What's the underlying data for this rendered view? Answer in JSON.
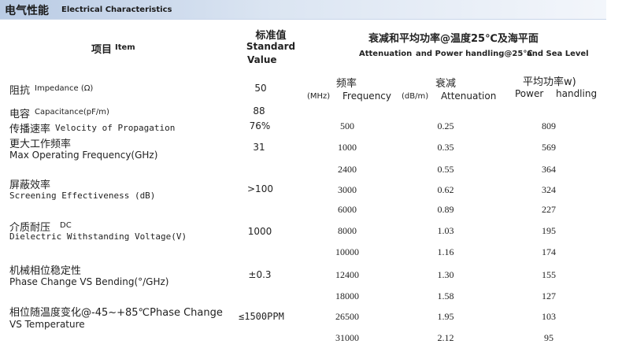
{
  "section": {
    "title_zh": "电气性能",
    "title_en": "Electrical Characteristics"
  },
  "headers": {
    "item_zh": "项目",
    "item_en": "Item",
    "std_zh": "标准值",
    "std_en1": "Standard",
    "std_en2": "Value",
    "atten_zh": "衰减和平均功率@温度25℃及海平面",
    "atten_en_a": "Attenuation",
    "atten_en_b": "and Power handling@25℃",
    "atten_en_c": "and Sea Level",
    "freq_unit": "(MHz)",
    "freq_zh": "频率",
    "freq_en": "Frequency",
    "att_unit": "(dB/m)",
    "att_zh": "衰减",
    "att_en": "Attenuation",
    "pow_zh": "平均功率w)",
    "pow_en1": "Power",
    "pow_en2": "handling"
  },
  "items": [
    {
      "zh": "阻抗",
      "en": "Impedance (Ω)",
      "value": "50"
    },
    {
      "zh": "电容",
      "en": "Capacitance(pF/m)",
      "value": "88"
    },
    {
      "zh": "传播速率",
      "en": "Velocity  of Propagation",
      "value": "76%"
    },
    {
      "zh": "更大工作频率",
      "en": "Max  Operating  Frequency(GHz)",
      "value": "31"
    },
    {
      "zh": "屏蔽效率",
      "en": "Screening Effectiveness (dB)",
      "value": ">100"
    },
    {
      "zh": "介质耐压",
      "zh_suffix": "DC",
      "en": "Dielectric Withstanding Voltage(V)",
      "value": "1000"
    },
    {
      "zh": "机械相位稳定性",
      "en": "Phase Change VS Bending(°/GHz)",
      "value": "±0.3"
    },
    {
      "zh": "相位随温度变化@-45~+85℃Phase Change",
      "en": "VS Temperature",
      "value": "≤1500PPM"
    }
  ],
  "attenuation_rows": [
    {
      "freq": "500",
      "att": "0.25",
      "power": "809"
    },
    {
      "freq": "1000",
      "att": "0.35",
      "power": "569"
    },
    {
      "freq": "2400",
      "att": "0.55",
      "power": "364"
    },
    {
      "freq": "3000",
      "att": "0.62",
      "power": "324"
    },
    {
      "freq": "6000",
      "att": "0.89",
      "power": "227"
    },
    {
      "freq": "8000",
      "att": "1.03",
      "power": "195"
    },
    {
      "freq": "10000",
      "att": "1.16",
      "power": "174"
    },
    {
      "freq": "12400",
      "att": "1.30",
      "power": "155"
    },
    {
      "freq": "18000",
      "att": "1.58",
      "power": "127"
    },
    {
      "freq": "26500",
      "att": "1.95",
      "power": "103"
    },
    {
      "freq": "31000",
      "att": "2.12",
      "power": "95"
    }
  ]
}
